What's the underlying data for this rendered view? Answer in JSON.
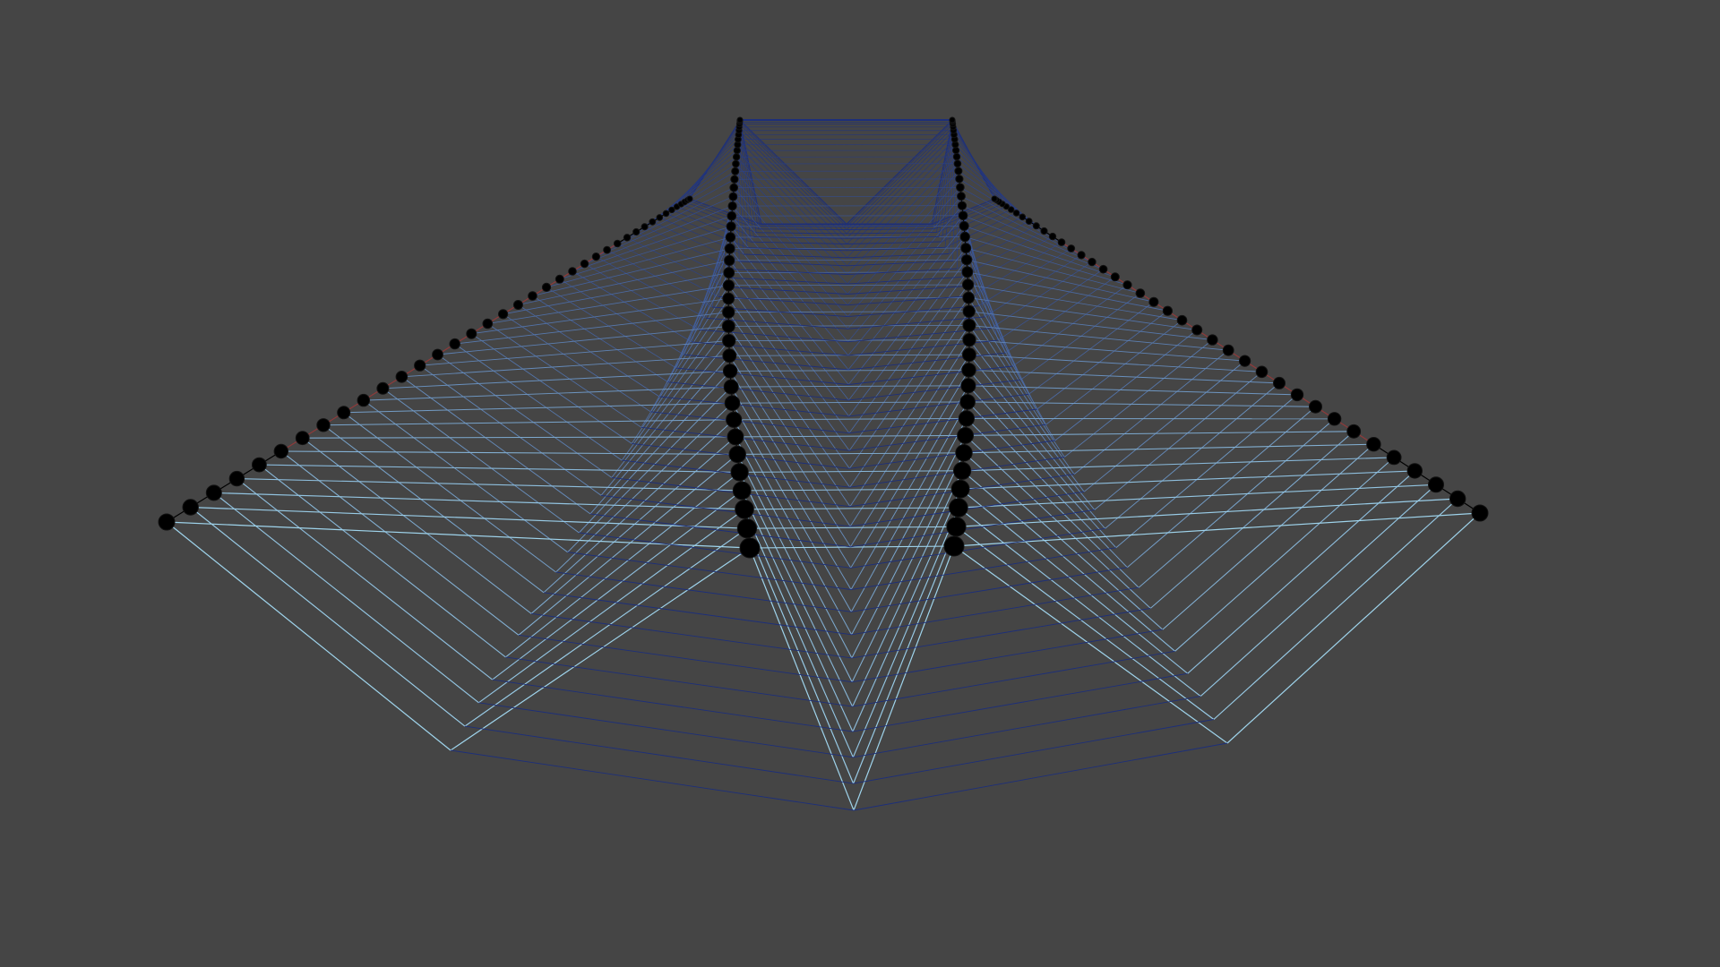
{
  "scene": {
    "background_color": "#454545",
    "node_color": "#000000",
    "node_outline_color": "#111111",
    "spine_edge_color": "#000000",
    "outer_edge_accent_color": "#8f3a3a",
    "near_web_color": "#9fd4ec",
    "far_web_color": "#1d2f7a",
    "ring_color": "#1d2f7a",
    "chain_count": 4,
    "nodes_per_chain": 40,
    "projection": "perspective"
  }
}
